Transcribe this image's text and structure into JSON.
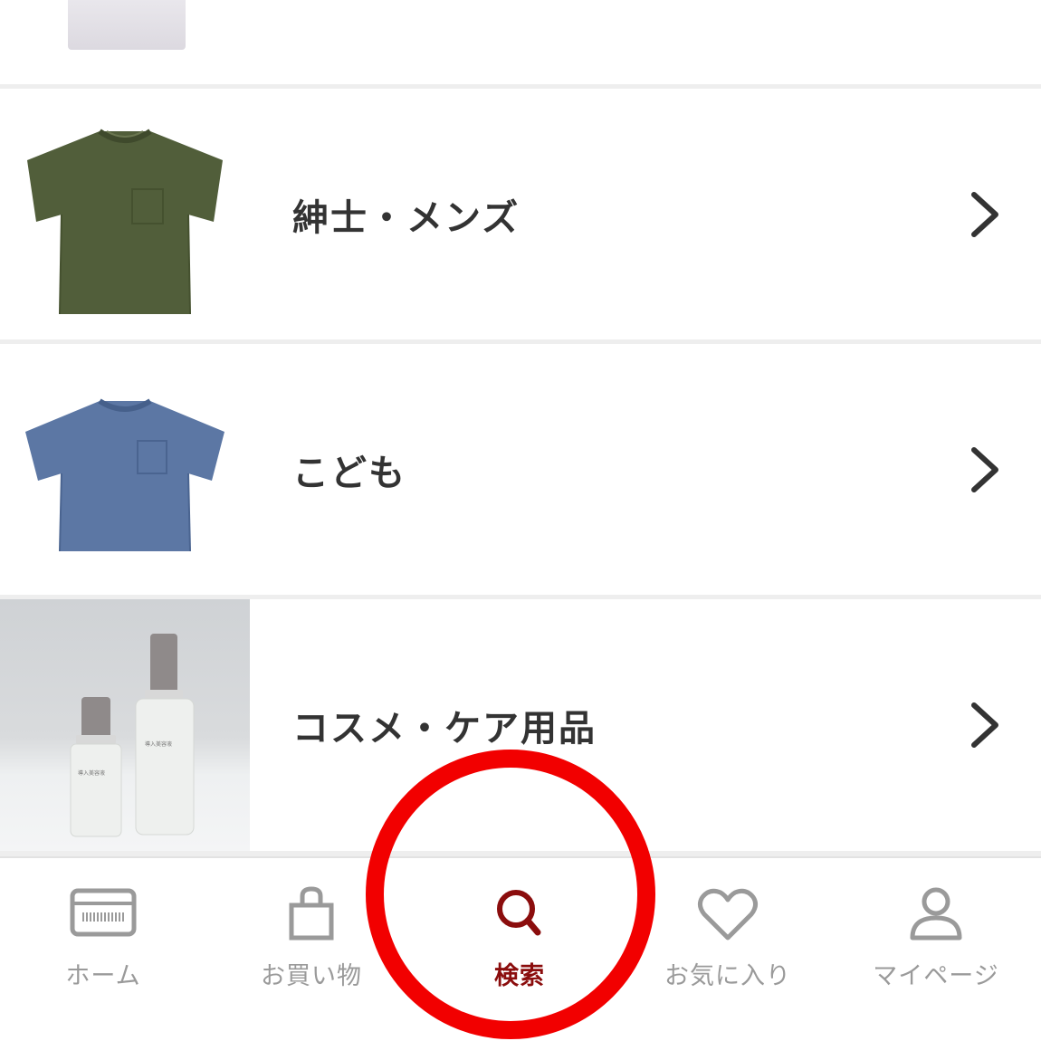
{
  "categories": [
    {
      "label": "紳士・メンズ",
      "image": "olive-tshirt"
    },
    {
      "label": "こども",
      "image": "blue-kids-tshirt"
    },
    {
      "label": "コスメ・ケア用品",
      "image": "cosmetic-bottles"
    }
  ],
  "cosmetics_photo_text": {
    "small_bottle": "導入美容液",
    "large_bottle": "導入美容液"
  },
  "bottom_nav": {
    "items": [
      {
        "label": "ホーム",
        "icon": "card-icon",
        "active": false
      },
      {
        "label": "お買い物",
        "icon": "shopping-bag-icon",
        "active": false
      },
      {
        "label": "検索",
        "icon": "search-icon",
        "active": true
      },
      {
        "label": "お気に入り",
        "icon": "heart-icon",
        "active": false
      },
      {
        "label": "マイページ",
        "icon": "user-icon",
        "active": false
      }
    ]
  },
  "colors": {
    "active": "#8b0d0d",
    "inactive": "#9a9a9a",
    "highlight": "#f20000",
    "label_text": "#333333"
  }
}
